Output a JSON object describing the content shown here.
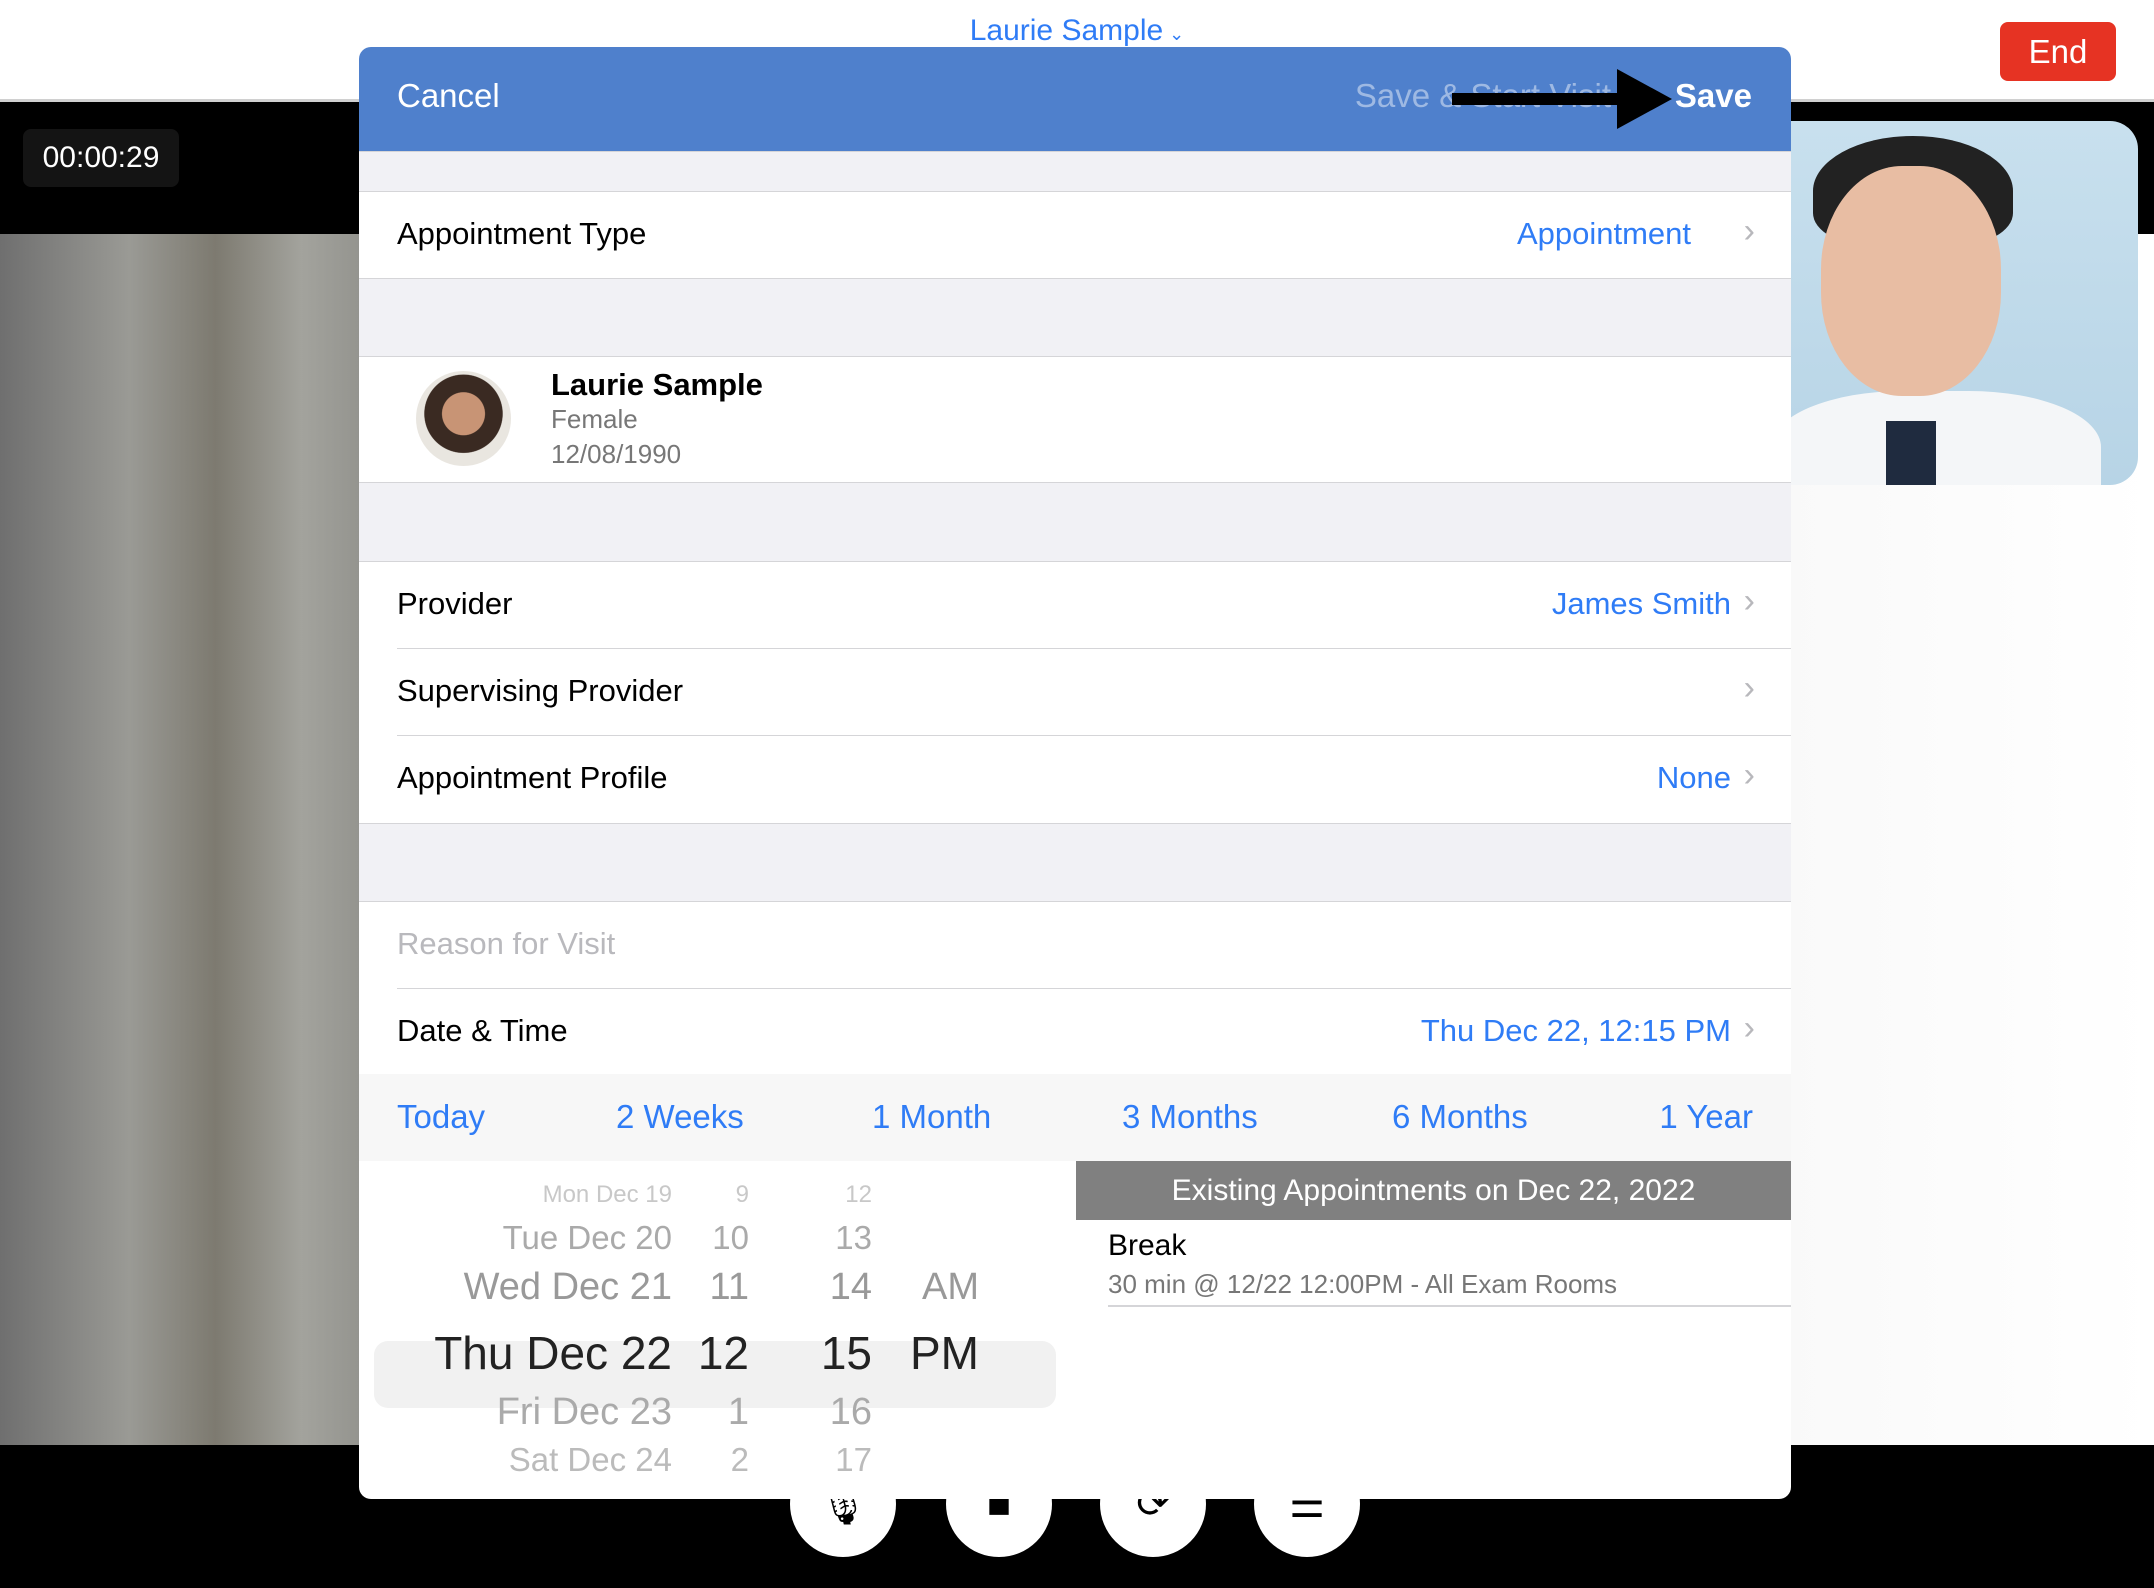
{
  "call": {
    "patient_title": "Laurie Sample",
    "end_label": "End",
    "timer": "00:00:29",
    "controls": [
      {
        "icon": "microphone-icon"
      },
      {
        "icon": "video-camera-icon"
      },
      {
        "icon": "camera-flip-icon"
      },
      {
        "icon": "menu-icon"
      }
    ]
  },
  "modal": {
    "cancel_label": "Cancel",
    "save_start_label": "Save & Start Visit",
    "save_label": "Save",
    "header_color": "#4f80cc",
    "appointment_type": {
      "label": "Appointment Type",
      "value": "Appointment"
    },
    "patient": {
      "name": "Laurie Sample",
      "sex": "Female",
      "dob": "12/08/1990"
    },
    "provider": {
      "label": "Provider",
      "value": "James Smith"
    },
    "supervising_provider": {
      "label": "Supervising Provider",
      "value": ""
    },
    "appointment_profile": {
      "label": "Appointment Profile",
      "value": "None"
    },
    "reason_placeholder": "Reason for Visit",
    "date_time": {
      "label": "Date & Time",
      "value": "Thu Dec 22, 12:15 PM"
    },
    "quick_ranges": [
      "Today",
      "2 Weeks",
      "1 Month",
      "3 Months",
      "6 Months",
      "1 Year"
    ],
    "picker": {
      "rows": [
        {
          "day": "Mon Dec 19",
          "hour": "9",
          "minute": "12",
          "ampm": ""
        },
        {
          "day": "Tue Dec 20",
          "hour": "10",
          "minute": "13",
          "ampm": ""
        },
        {
          "day": "Wed Dec 21",
          "hour": "11",
          "minute": "14",
          "ampm": "AM"
        },
        {
          "day": "Thu Dec 22",
          "hour": "12",
          "minute": "15",
          "ampm": "PM"
        },
        {
          "day": "Fri Dec 23",
          "hour": "1",
          "minute": "16",
          "ampm": ""
        },
        {
          "day": "Sat Dec 24",
          "hour": "2",
          "minute": "17",
          "ampm": ""
        }
      ]
    },
    "existing": {
      "header": "Existing Appointments on Dec 22, 2022",
      "items": [
        {
          "title": "Break",
          "detail": "30 min @ 12/22 12:00PM - All Exam Rooms"
        }
      ]
    }
  }
}
